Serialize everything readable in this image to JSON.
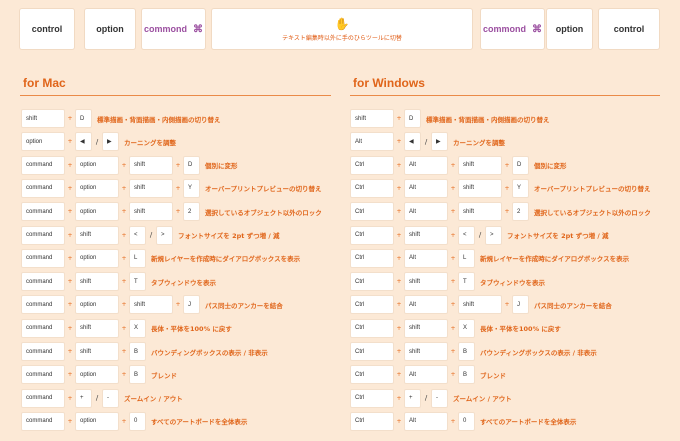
{
  "top_keys": {
    "left": [
      "control",
      "option",
      "commond"
    ],
    "center_label": "テキスト編集時以外に手のひらツールに切替",
    "right": [
      "commond",
      "option",
      "control"
    ]
  },
  "sections": {
    "mac_title": "for Mac",
    "windows_title": "for Windows"
  },
  "mac": [
    {
      "keys": [
        "shift",
        "D"
      ],
      "desc": "標準描画・背面描画・内側描画の切り替え"
    },
    {
      "keys": [
        "option",
        "◀",
        "/",
        "▶"
      ],
      "desc": "カーニングを調整"
    },
    {
      "keys": [
        "command",
        "option",
        "shift",
        "D"
      ],
      "desc": "個別に変形"
    },
    {
      "keys": [
        "command",
        "option",
        "shift",
        "Y"
      ],
      "desc": "オーバープリントプレビューの切り替え"
    },
    {
      "keys": [
        "command",
        "option",
        "shift",
        "2"
      ],
      "desc": "選択しているオブジェクト以外のロック"
    },
    {
      "keys": [
        "command",
        "shift",
        "<",
        "/",
        ">"
      ],
      "desc": "フォントサイズを 2pt ずつ増 / 減"
    },
    {
      "keys": [
        "command",
        "option",
        "L"
      ],
      "desc": "新規レイヤーを作成時にダイアログボックスを表示"
    },
    {
      "keys": [
        "command",
        "shift",
        "T"
      ],
      "desc": "タブウィンドウを表示"
    },
    {
      "keys": [
        "command",
        "option",
        "shift",
        "J"
      ],
      "desc": "パス同士のアンカーを結合"
    },
    {
      "keys": [
        "command",
        "shift",
        "X"
      ],
      "desc": "長体・平体を100% に戻す"
    },
    {
      "keys": [
        "command",
        "shift",
        "B"
      ],
      "desc": "バウンディングボックスの表示 / 非表示"
    },
    {
      "keys": [
        "command",
        "option",
        "B"
      ],
      "desc": "ブレンド"
    },
    {
      "keys": [
        "command",
        "+",
        "/",
        "-"
      ],
      "desc": "ズームイン / アウト"
    },
    {
      "keys": [
        "command",
        "option",
        "0"
      ],
      "desc": "すべてのアートボードを全体表示"
    }
  ],
  "win": [
    {
      "keys": [
        "shift",
        "D"
      ],
      "desc": "標準描画・背面描画・内側描画の切り替え"
    },
    {
      "keys": [
        "Alt",
        "◀",
        "/",
        "▶"
      ],
      "desc": "カーニングを調整"
    },
    {
      "keys": [
        "Ctrl",
        "Alt",
        "shift",
        "D"
      ],
      "desc": "個別に変形"
    },
    {
      "keys": [
        "Ctrl",
        "Alt",
        "shift",
        "Y"
      ],
      "desc": "オーバープリントプレビューの切り替え"
    },
    {
      "keys": [
        "Ctrl",
        "Alt",
        "shift",
        "2"
      ],
      "desc": "選択しているオブジェクト以外のロック"
    },
    {
      "keys": [
        "Ctrl",
        "shift",
        "<",
        "/",
        ">"
      ],
      "desc": "フォントサイズを 2pt ずつ増 / 減"
    },
    {
      "keys": [
        "Ctrl",
        "Alt",
        "L"
      ],
      "desc": "新規レイヤーを作成時にダイアログボックスを表示"
    },
    {
      "keys": [
        "Ctrl",
        "shift",
        "T"
      ],
      "desc": "タブウィンドウを表示"
    },
    {
      "keys": [
        "Ctrl",
        "Alt",
        "shift",
        "J"
      ],
      "desc": "パス同士のアンカーを結合"
    },
    {
      "keys": [
        "Ctrl",
        "shift",
        "X"
      ],
      "desc": "長体・平体を100% に戻す"
    },
    {
      "keys": [
        "Ctrl",
        "shift",
        "B"
      ],
      "desc": "バウンディングボックスの表示 / 非表示"
    },
    {
      "keys": [
        "Ctrl",
        "Alt",
        "B"
      ],
      "desc": "ブレンド"
    },
    {
      "keys": [
        "Ctrl",
        "+",
        "/",
        "-"
      ],
      "desc": "ズームイン / アウト"
    },
    {
      "keys": [
        "Ctrl",
        "Alt",
        "0"
      ],
      "desc": "すべてのアートボードを全体表示"
    }
  ]
}
